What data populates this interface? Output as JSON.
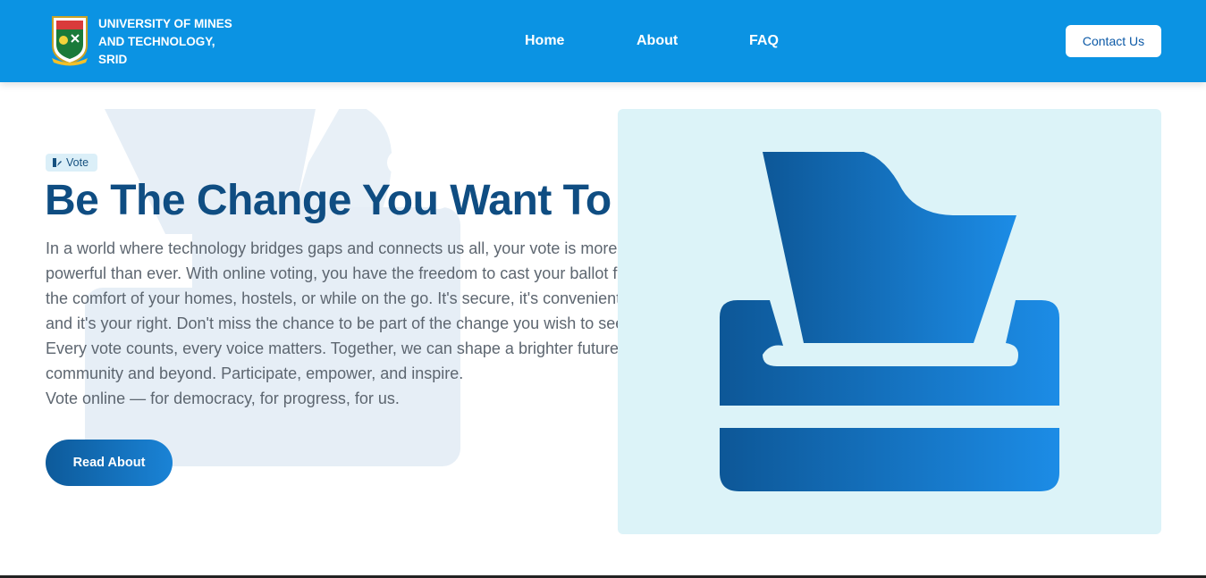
{
  "header": {
    "brand_lines": [
      "UNIVERSITY OF MINES",
      "AND TECHNOLOGY,",
      "SRID"
    ],
    "nav": [
      {
        "label": "Home"
      },
      {
        "label": "About"
      },
      {
        "label": "FAQ"
      }
    ],
    "contact_label": "Contact Us",
    "background_color": "#0b93e3",
    "logo_icon": "university-crest-icon"
  },
  "hero": {
    "badge_label": "Vote",
    "badge_icon": "vote-icon",
    "headline": "Be The Change You Want To See!",
    "body_lines": [
      "In a world where technology bridges gaps and connects us all, your vote is more",
      "powerful than ever. With online voting, you have the freedom to cast your ballot from",
      "the comfort of your homes, hostels, or while on the go. It's secure, it's convenient,",
      "and it's your right. Don't miss the chance to be part of the change you wish to see.",
      "Every vote counts, every voice matters. Together, we can shape a brighter future for our",
      "community and beyond. Participate, empower, and inspire.",
      "Vote online — for democracy, for progress, for us."
    ],
    "cta_label": "Read About",
    "headline_color": "#0f4d82",
    "illustration_icon": "ballot-box-icon",
    "background_icon": "checkmark-vote-icon"
  }
}
